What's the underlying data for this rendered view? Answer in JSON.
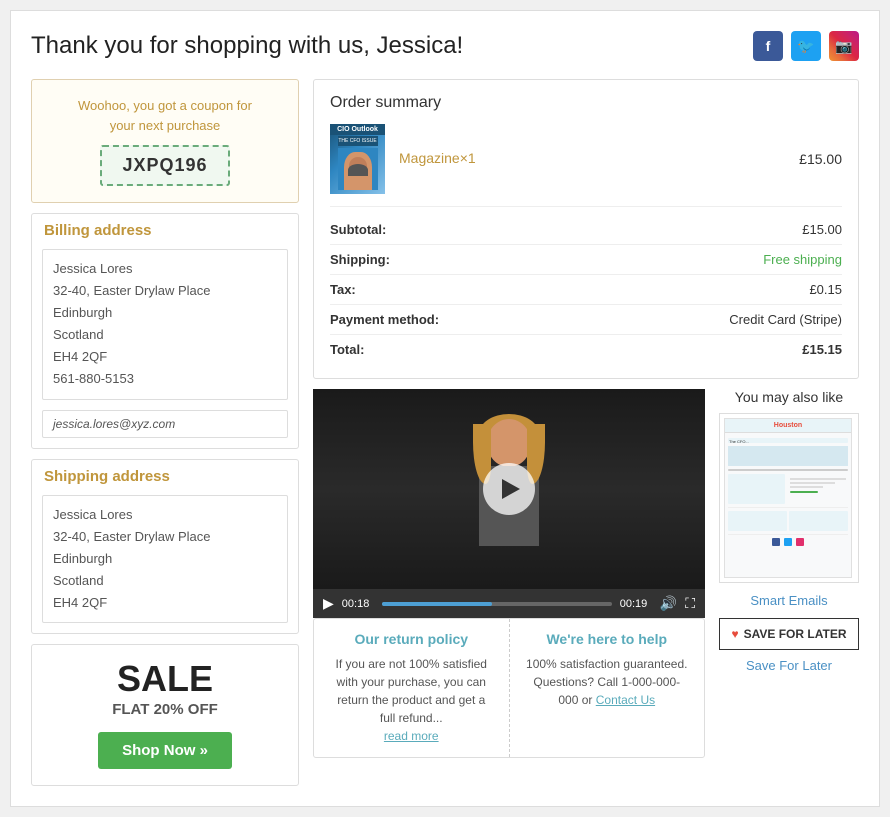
{
  "header": {
    "title": "Thank you for shopping with us, Jessica!",
    "social": {
      "facebook_label": "f",
      "twitter_label": "t",
      "instagram_label": "ig"
    }
  },
  "coupon": {
    "text_line1": "Woohoo, you got a coupon for",
    "text_line2": "your next purchase",
    "code": "JXPQ196"
  },
  "billing": {
    "title": "Billing address",
    "name": "Jessica Lores",
    "address1": "32-40, Easter Drylaw Place",
    "city": "Edinburgh",
    "region": "Scotland",
    "postcode": "EH4 2QF",
    "phone": "561-880-5153",
    "email": "jessica.lores@xyz.com"
  },
  "shipping": {
    "title": "Shipping address",
    "name": "Jessica Lores",
    "address1": "32-40, Easter Drylaw Place",
    "city": "Edinburgh",
    "region": "Scotland",
    "postcode": "EH4 2QF"
  },
  "sale": {
    "title": "SALE",
    "subtitle": "FLAT 20% OFF",
    "button_label": "Shop Now »"
  },
  "order_summary": {
    "title": "Order summary",
    "item_name": "Magazine",
    "item_qty": "×1",
    "item_price": "£15.00",
    "rows": [
      {
        "label": "Subtotal:",
        "value": "£15.00",
        "type": "normal"
      },
      {
        "label": "Shipping:",
        "value": "Free shipping",
        "type": "free-shipping"
      },
      {
        "label": "Tax:",
        "value": "£0.15",
        "type": "normal"
      },
      {
        "label": "Payment method:",
        "value": "Credit Card (Stripe)",
        "type": "normal"
      },
      {
        "label": "Total:",
        "value": "£15.15",
        "type": "total"
      }
    ]
  },
  "video": {
    "time_elapsed": "00:18",
    "time_remaining": "00:19"
  },
  "policy": {
    "return": {
      "title": "Our return policy",
      "text": "If you are not 100% satisfied with your purchase, you can return the product and get a full refund...",
      "read_more": "read more"
    },
    "help": {
      "title": "We're here to help",
      "text": "100% satisfaction guaranteed. Questions? Call 1-000-000-000 or",
      "contact_link": "Contact Us"
    }
  },
  "may_also_like": {
    "title": "You may also like",
    "product_name": "Smart Emails",
    "save_later_btn": "SAVE FOR LATER",
    "save_later_label": "Save For Later",
    "email_preview_header": "Houston"
  }
}
